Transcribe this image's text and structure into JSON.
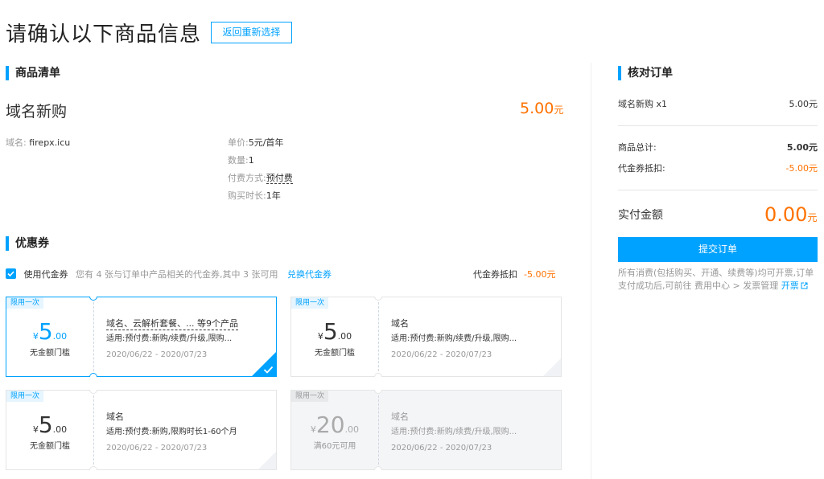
{
  "page": {
    "title": "请确认以下商品信息",
    "back_button": "返回重新选择"
  },
  "product_list": {
    "section_title": "商品清单",
    "product_name": "域名新购",
    "price": "5.00",
    "price_unit": "元",
    "domain_label": "域名:",
    "domain_value": "firepx.icu",
    "details": [
      {
        "label": "单价:",
        "value": "5元/首年"
      },
      {
        "label": "数量:",
        "value": "1"
      },
      {
        "label": "付费方式:",
        "value": "预付费"
      },
      {
        "label": "购买时长:",
        "value": "1年"
      }
    ]
  },
  "coupons": {
    "section_title": "优惠券",
    "use_label": "使用代金券",
    "use_checked": true,
    "description": "您有 4 张与订单中产品相关的代金券,其中 3 张可用",
    "exchange_link": "兑换代金券",
    "deduct_label": "代金券抵扣",
    "deduct_value": "-5.00元",
    "items": [
      {
        "tag": "限用一次",
        "currency": "¥",
        "amount_int": "5",
        "amount_dec": ".00",
        "threshold": "无金额门槛",
        "title": "域名、云解析套餐、... 等9个产品",
        "scope": "适用:预付费:新购/续费/升级,限购...",
        "date": "2020/06/22 - 2020/07/23",
        "selected": true,
        "disabled": false
      },
      {
        "tag": "限用一次",
        "currency": "¥",
        "amount_int": "5",
        "amount_dec": ".00",
        "threshold": "无金额门槛",
        "title": "域名",
        "scope": "适用:预付费:新购/续费/升级,限购...",
        "date": "2020/06/22 - 2020/07/23",
        "selected": false,
        "disabled": false
      },
      {
        "tag": "限用一次",
        "currency": "¥",
        "amount_int": "5",
        "amount_dec": ".00",
        "threshold": "无金额门槛",
        "title": "域名",
        "scope": "适用:预付费:新购,限购时长1-60个月",
        "date": "2020/06/22 - 2020/07/23",
        "selected": false,
        "disabled": false
      },
      {
        "tag": "限用一次",
        "currency": "¥",
        "amount_int": "20",
        "amount_dec": ".00",
        "threshold": "满60元可用",
        "title": "域名",
        "scope": "适用:预付费:新购/续费/升级,限购...",
        "date": "2020/06/22 - 2020/07/23",
        "selected": false,
        "disabled": true
      }
    ]
  },
  "order_summary": {
    "section_title": "核对订单",
    "item_label": "域名新购 x1",
    "item_value": "5.00元",
    "total_label": "商品总计:",
    "total_value": "5.00元",
    "coupon_label": "代金券抵扣:",
    "coupon_value": "-5.00元",
    "pay_label": "实付金额",
    "pay_amount": "0.00",
    "pay_unit": "元",
    "submit_button": "提交订单",
    "note": "所有消费(包括购买、开通、续费等)均可开票,订单支付成功后,可前往 费用中心 > 发票管理",
    "invoice_link": "开票"
  },
  "colors": {
    "accent": "#00a2ff",
    "price": "#ff7200"
  },
  "icons": [
    "checkbox-checked-icon",
    "checkmark-icon",
    "external-link-icon"
  ]
}
